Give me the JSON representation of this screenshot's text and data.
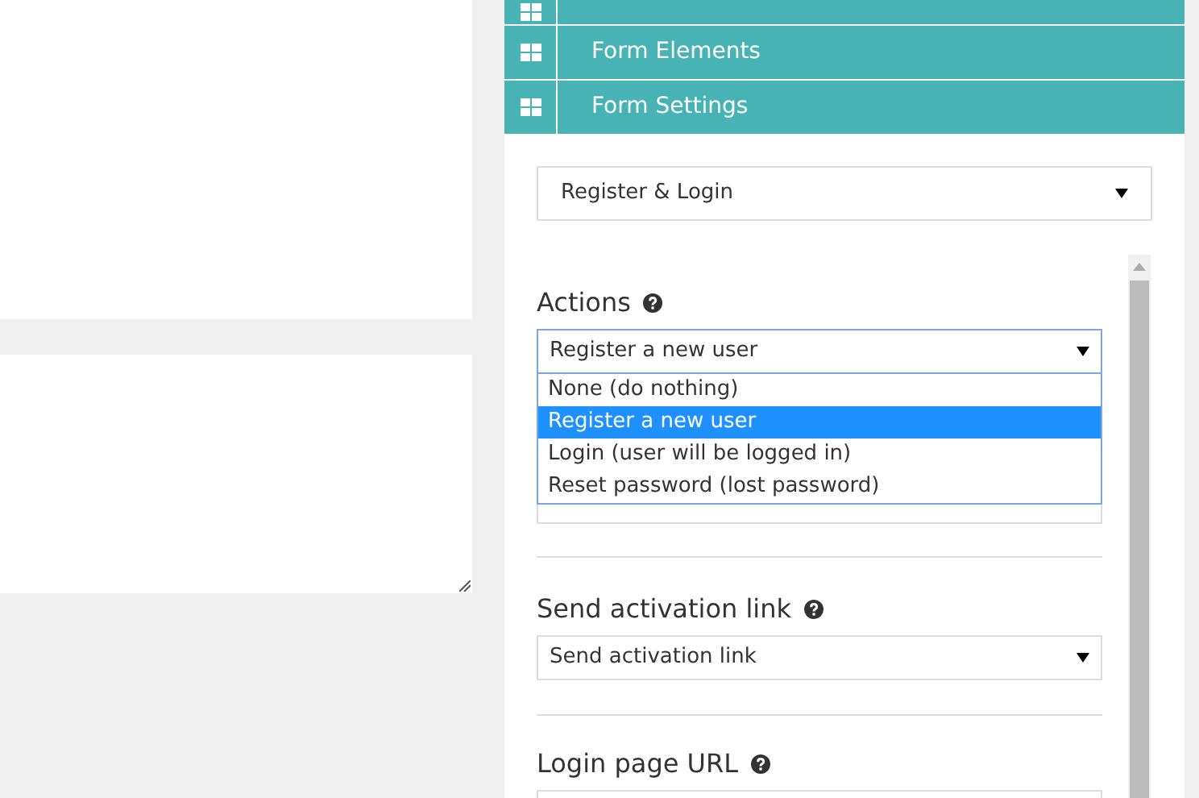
{
  "panels": [
    {
      "kind": "cut"
    },
    {
      "label": "Form Elements"
    },
    {
      "label": "Form Settings"
    }
  ],
  "form_type": {
    "value": "Register & Login"
  },
  "actions": {
    "label": "Actions",
    "value": "Register a new user",
    "expanded": true,
    "options": [
      {
        "label": "None (do nothing)",
        "selected": false
      },
      {
        "label": "Register a new user",
        "selected": true
      },
      {
        "label": "Login (user will be logged in)",
        "selected": false
      },
      {
        "label": "Reset password (lost password)",
        "selected": false
      }
    ]
  },
  "activation": {
    "label": "Send activation link",
    "value": "Send activation link"
  },
  "login_url": {
    "label": "Login page URL"
  }
}
